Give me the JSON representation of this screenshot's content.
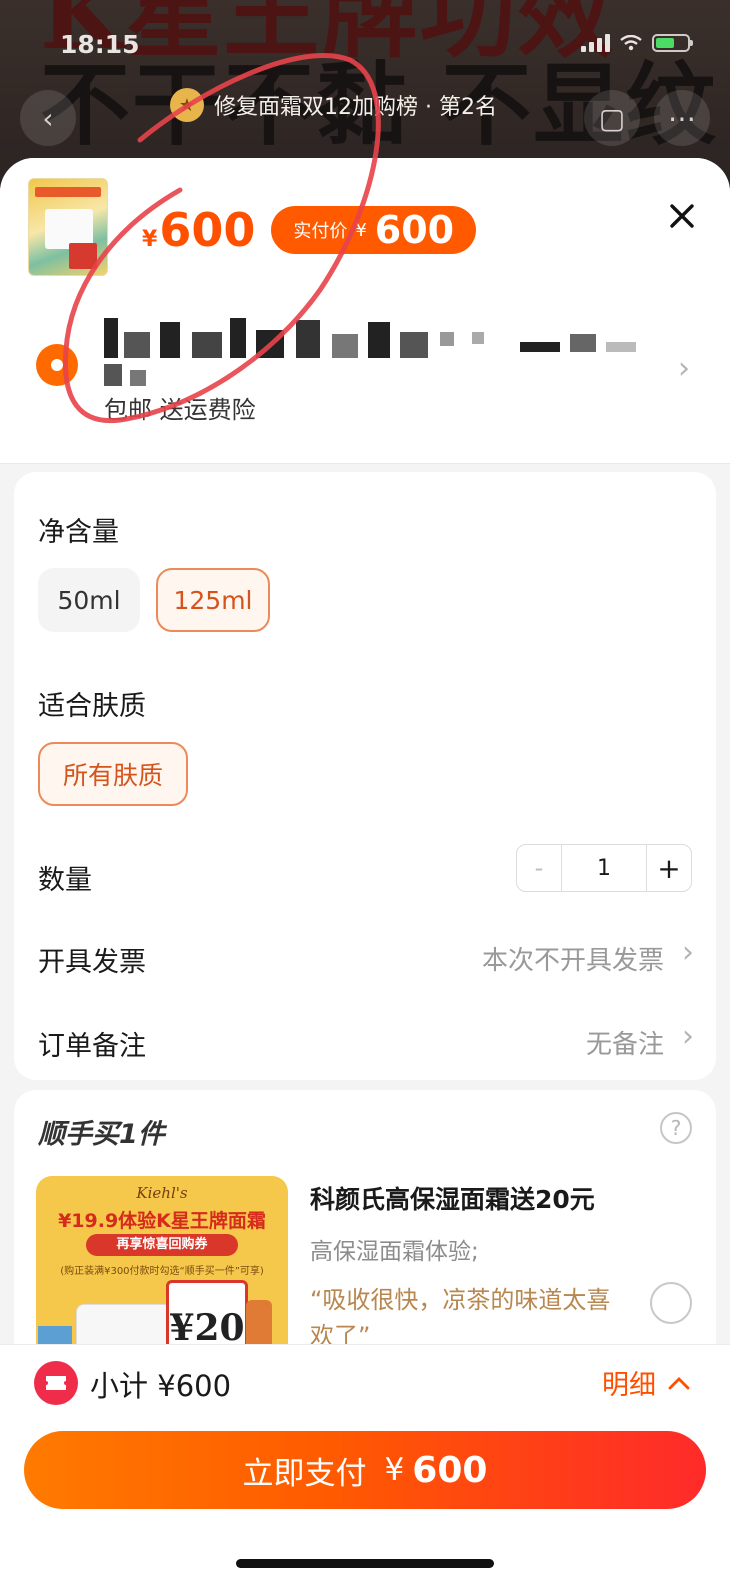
{
  "status_bar": {
    "time": "18:15"
  },
  "background": {
    "heading_line1": "K星王牌功效",
    "heading_line2": "不干不黏 不显纹",
    "rank_text": "修复面霜双12加购榜 · 第2名"
  },
  "product": {
    "currency": "¥",
    "price": "600",
    "actual_pay_label": "实付价",
    "actual_pay_currency": "¥",
    "actual_pay_value": "600",
    "shipping_note": "包邮 送运费险"
  },
  "options": {
    "net_content": {
      "label": "净含量",
      "choices": [
        {
          "label": "50ml",
          "selected": false
        },
        {
          "label": "125ml",
          "selected": true
        }
      ]
    },
    "skin_type": {
      "label": "适合肤质",
      "choices": [
        {
          "label": "所有肤质",
          "selected": true
        }
      ]
    },
    "quantity": {
      "label": "数量",
      "minus": "-",
      "value": "1",
      "plus": "+"
    },
    "invoice": {
      "label": "开具发票",
      "value": "本次不开具发票"
    },
    "remark": {
      "label": "订单备注",
      "value": "无备注"
    }
  },
  "addon": {
    "title": "顺手买1件",
    "help": "?",
    "image": {
      "brand": "Kiehl's",
      "promo": "¥19.9体验K星王牌面霜",
      "promo2": "再享惊喜回购券",
      "tiny": "(购正装满¥300付款时勾选“顺手买一件”可享)",
      "coupon": "¥20"
    },
    "name": "科颜氏高保湿面霜送20元",
    "subtitle": "高保湿面霜体验;",
    "quote": "“吸收很快，凉茶的味道太喜欢了”"
  },
  "footer": {
    "subtotal_label": "小计",
    "subtotal_currency": "¥",
    "subtotal_value": "600",
    "detail_label": "明细",
    "pay_label": "立即支付",
    "pay_currency": "¥",
    "pay_value": "600"
  },
  "colors": {
    "accent": "#ff5000",
    "pay_gradient_start": "#ff7a00",
    "pay_gradient_end": "#ff2a2a",
    "annotation": "#e8434a"
  }
}
